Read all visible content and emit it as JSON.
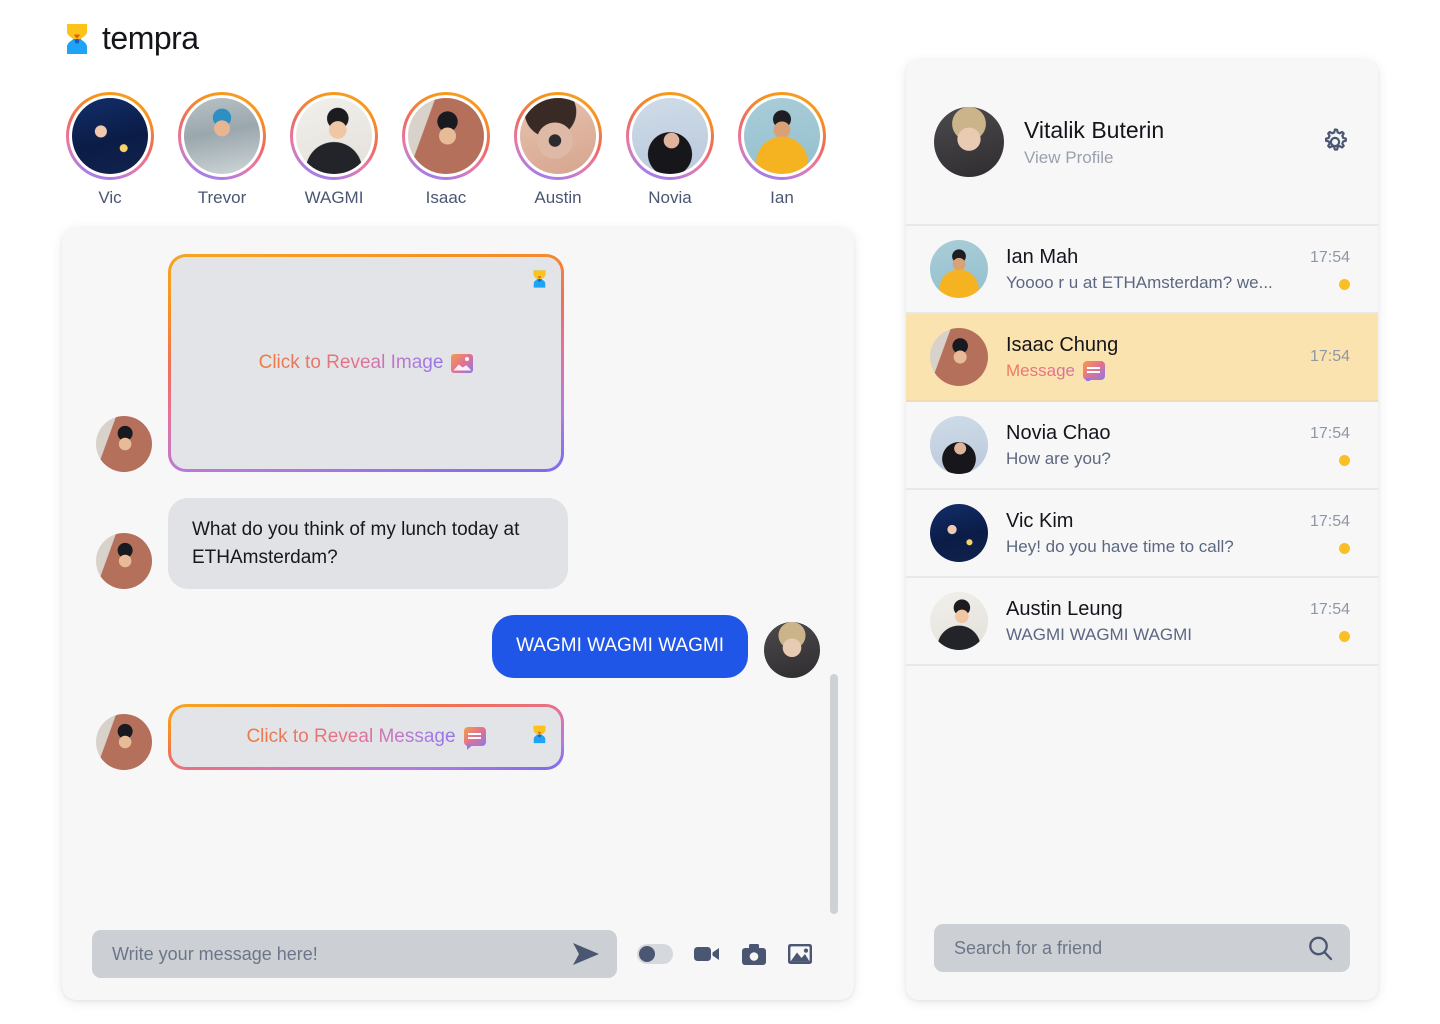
{
  "brand": {
    "name": "tempra",
    "logo_icon": "hourglass-icon"
  },
  "stories": [
    {
      "name": "Vic",
      "avatar_kind": "woman-night-lights"
    },
    {
      "name": "Trevor",
      "avatar_kind": "man-bandana-lake"
    },
    {
      "name": "WAGMI",
      "avatar_kind": "man-black-jacket"
    },
    {
      "name": "Isaac",
      "avatar_kind": "man-glasses-street"
    },
    {
      "name": "Austin",
      "avatar_kind": "closeup-eye-glasses"
    },
    {
      "name": "Novia",
      "avatar_kind": "woman-looking-up"
    },
    {
      "name": "Ian",
      "avatar_kind": "man-yellow-shirt"
    }
  ],
  "chat": {
    "messages": [
      {
        "type": "reveal-image",
        "side": "left",
        "text": "Click to Reveal Image",
        "icon": "picture-icon",
        "badge": "hourglass-icon"
      },
      {
        "type": "text",
        "side": "left",
        "text": "What do you think of my lunch today at ETHAmsterdam?"
      },
      {
        "type": "text",
        "side": "right",
        "text": "WAGMI WAGMI WAGMI"
      },
      {
        "type": "reveal-message",
        "side": "left",
        "text": "Click to Reveal Message",
        "icon": "chat-bubble-icon",
        "badge": "hourglass-icon"
      }
    ],
    "composer": {
      "placeholder": "Write your message here!",
      "value": "",
      "send_icon": "send-icon",
      "toggle_state": "off",
      "video_icon": "video-camera-icon",
      "camera_icon": "camera-icon",
      "image_icon": "image-icon"
    }
  },
  "sidebar": {
    "profile": {
      "name": "Vitalik Buterin",
      "subtitle": "View Profile",
      "settings_icon": "gear-icon"
    },
    "conversations": [
      {
        "name": "Ian Mah",
        "preview": "Yoooo r u at ETHAmsterdam? we...",
        "time": "17:54",
        "unread": true,
        "active": false,
        "gradient_preview": false
      },
      {
        "name": "Isaac Chung",
        "preview": "Message",
        "time": "17:54",
        "unread": false,
        "active": true,
        "gradient_preview": true,
        "preview_icon": "chat-bubble-icon"
      },
      {
        "name": "Novia Chao",
        "preview": "How are you?",
        "time": "17:54",
        "unread": true,
        "active": false,
        "gradient_preview": false
      },
      {
        "name": "Vic Kim",
        "preview": "Hey! do you have time to call?",
        "time": "17:54",
        "unread": true,
        "active": false,
        "gradient_preview": false
      },
      {
        "name": "Austin Leung",
        "preview": "WAGMI WAGMI WAGMI",
        "time": "17:54",
        "unread": true,
        "active": false,
        "gradient_preview": false
      }
    ],
    "search": {
      "placeholder": "Search for a friend",
      "value": "",
      "icon": "search-icon"
    }
  },
  "colors": {
    "accent_blue": "#1f56e8",
    "unread_dot": "#fbbf24",
    "active_row": "#fbe3b0",
    "gradient_start": "#f5a623",
    "gradient_end": "#7a6bec",
    "panel_bg": "#f7f7f8"
  }
}
